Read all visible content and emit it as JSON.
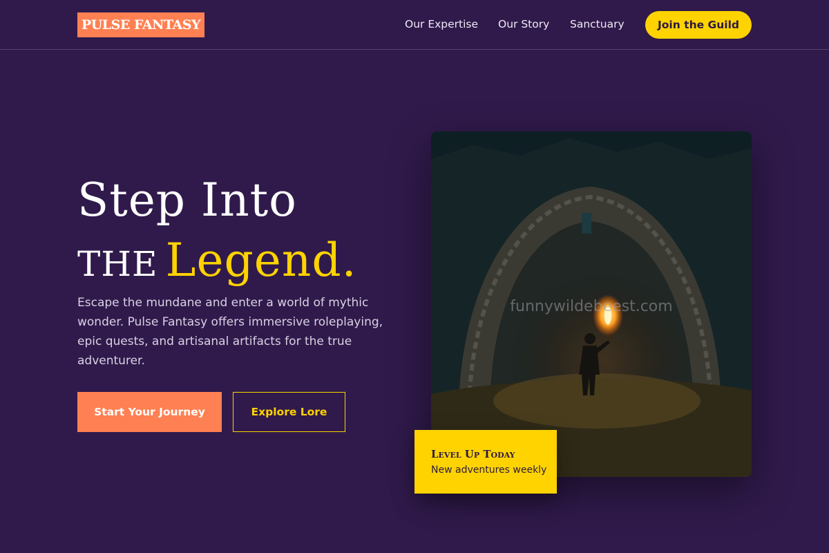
{
  "header": {
    "logo": "PULSE FANTASY",
    "nav": [
      "Our Expertise",
      "Our Story",
      "Sanctuary"
    ],
    "cta": "Join the Guild"
  },
  "hero": {
    "headline_line1": "Step Into",
    "headline_line2_prefix": "the",
    "headline_line2_accent": "Legend.",
    "description": "Escape the mundane and enter a world of mythic wonder. Pulse Fantasy offers immersive roleplaying, epic quests, and artisanal artifacts for the true adventurer.",
    "primary_button": "Start Your Journey",
    "secondary_button": "Explore Lore",
    "image_watermark": "funnywildebeest.com",
    "badge_title": "Level Up Today",
    "badge_subtitle": "New adventures weekly"
  },
  "colors": {
    "background": "#301a4b",
    "accent_orange": "#ff8052",
    "accent_yellow": "#ffd300",
    "text_light": "#d9d1e4"
  },
  "icons": []
}
